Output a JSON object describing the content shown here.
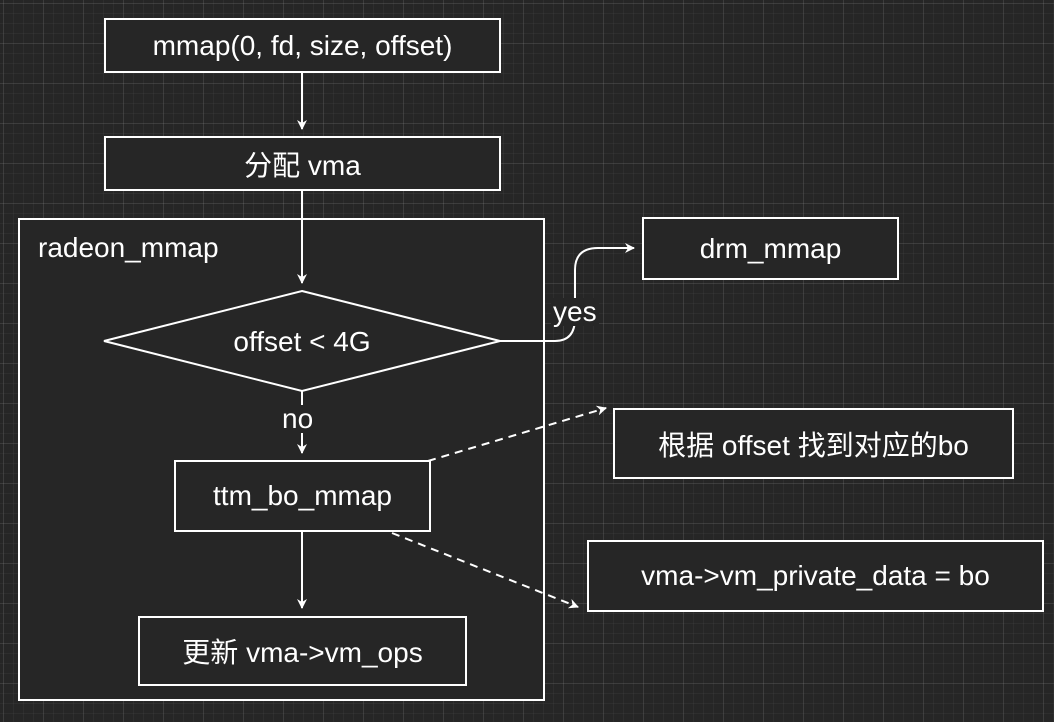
{
  "nodes": {
    "mmap_call": "mmap(0, fd, size, offset)",
    "alloc_vma": "分配 vma",
    "radeon_container": "radeon_mmap",
    "decision": "offset < 4G",
    "drm_mmap": "drm_mmap",
    "ttm_bo_mmap": "ttm_bo_mmap",
    "update_vm_ops": "更新 vma->vm_ops",
    "find_bo_note": "根据 offset 找到对应的bo",
    "private_data_note": "vma->vm_private_data = bo"
  },
  "edges": {
    "yes_label": "yes",
    "no_label": "no"
  },
  "colors": {
    "background": "#262626",
    "stroke": "#ffffff",
    "text": "#ffffff"
  }
}
